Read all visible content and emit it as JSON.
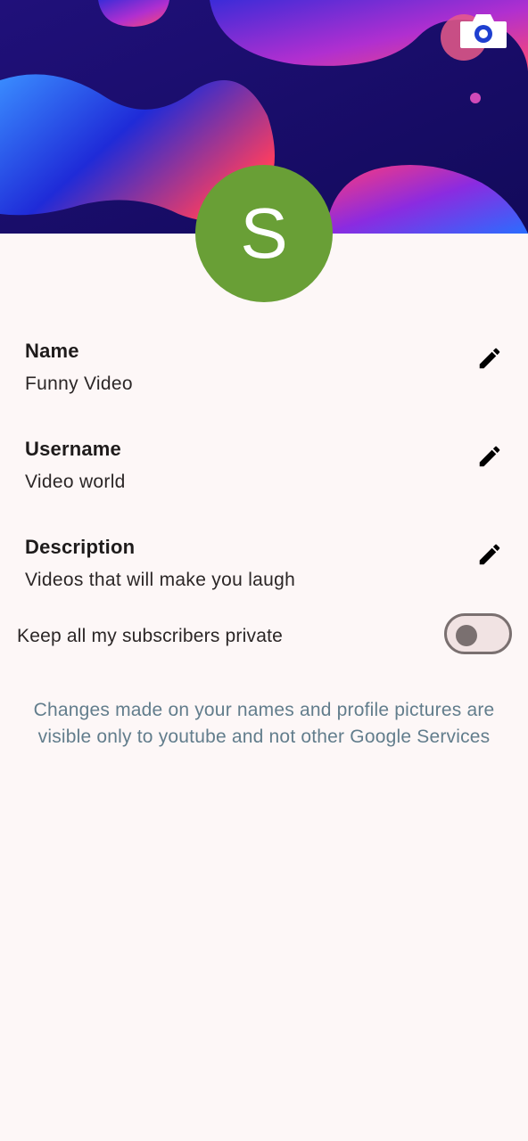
{
  "banner": {
    "background_color": "#1a0d6e",
    "camera_icon": "camera-icon"
  },
  "avatar": {
    "initial": "S",
    "color": "#699f36"
  },
  "fields": [
    {
      "label": "Name",
      "value": "Funny Video",
      "icon": "pencil-icon"
    },
    {
      "label": "Username",
      "value": "Video world",
      "icon": "pencil-icon"
    },
    {
      "label": "Description",
      "value": "Videos that will make you laugh",
      "icon": "pencil-icon"
    }
  ],
  "privacy": {
    "label": "Keep all my subscribers private",
    "enabled": false
  },
  "note": {
    "line1": "Changes made on your names and profile pictures are",
    "line2": "visible only to youtube and not other Google Services"
  }
}
